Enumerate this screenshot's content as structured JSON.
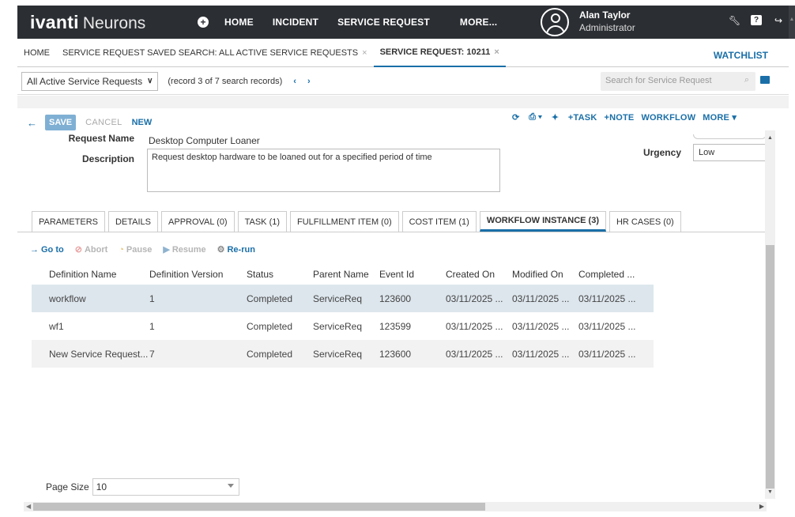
{
  "header": {
    "brand_main": "ivanti",
    "brand_sub": "Neurons",
    "nav": [
      "HOME",
      "INCIDENT",
      "SERVICE REQUEST",
      "MORE..."
    ],
    "user_name": "Alan Taylor",
    "user_role": "Administrator",
    "icons": [
      "plus-icon",
      "wrench-icon",
      "help-icon",
      "logout-icon"
    ]
  },
  "tabs": {
    "items": [
      {
        "label": "HOME"
      },
      {
        "label": "SERVICE REQUEST SAVED SEARCH: ALL ACTIVE SERVICE REQUESTS"
      },
      {
        "label": "SERVICE REQUEST: 10211"
      }
    ],
    "close_glyph": "×",
    "watchlist": "WATCHLIST"
  },
  "search": {
    "saved_search": "All Active Service Requests",
    "record_info": "(record 3 of 7 search records)",
    "prev": "‹",
    "next": "›",
    "placeholder": "Search for Service Request"
  },
  "toolbar": {
    "back": "←",
    "save": "SAVE",
    "cancel": "CANCEL",
    "new": "NEW",
    "actions": [
      "+TASK",
      "+NOTE",
      "WORKFLOW",
      "MORE ▾"
    ]
  },
  "form": {
    "request_name_label": "Request Name",
    "request_name_value": "Desktop Computer Loaner",
    "description_label": "Description",
    "description_value": "Request desktop hardware to be loaned out for a specified period of time",
    "urgency_label": "Urgency",
    "urgency_value": "Low"
  },
  "detail_tabs": [
    {
      "label": "PARAMETERS"
    },
    {
      "label": "DETAILS"
    },
    {
      "label": "APPROVAL (0)"
    },
    {
      "label": "TASK (1)"
    },
    {
      "label": "FULFILLMENT ITEM (0)"
    },
    {
      "label": "COST ITEM (1)"
    },
    {
      "label": "WORKFLOW INSTANCE (3)"
    },
    {
      "label": "HR CASES (0)"
    }
  ],
  "workflow_actions": {
    "goto": "Go to",
    "abort": "Abort",
    "pause": "Pause",
    "resume": "Resume",
    "rerun": "Re-run"
  },
  "grid": {
    "columns": [
      "Definition Name",
      "Definition Version",
      "Status",
      "Parent Name",
      "Event Id",
      "Created On",
      "Modified On",
      "Completed ..."
    ],
    "rows": [
      [
        "workflow",
        "1",
        "Completed",
        "ServiceReq",
        "123600",
        "03/11/2025 ...",
        "03/11/2025 ...",
        "03/11/2025 ..."
      ],
      [
        "wf1",
        "1",
        "Completed",
        "ServiceReq",
        "123599",
        "03/11/2025 ...",
        "03/11/2025 ...",
        "03/11/2025 ..."
      ],
      [
        "New Service Request...",
        "7",
        "Completed",
        "ServiceReq",
        "123600",
        "03/11/2025 ...",
        "03/11/2025 ...",
        "03/11/2025 ..."
      ]
    ]
  },
  "paging": {
    "label": "Page Size",
    "value": "10"
  },
  "colors": {
    "accent": "#1a6fa8",
    "topbar": "#2b2e33",
    "selected_row": "#dde6ed"
  }
}
